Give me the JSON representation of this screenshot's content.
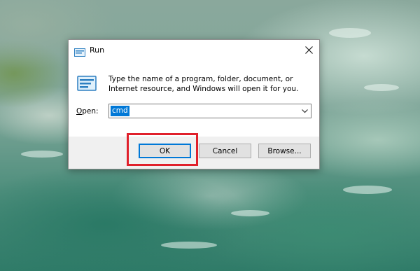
{
  "dialog": {
    "title": "Run",
    "description": "Type the name of a program, folder, document, or Internet resource, and Windows will open it for you.",
    "open_label_prefix": "",
    "open_label_underlined": "O",
    "open_label_rest": "pen:",
    "open_value": "cmd",
    "buttons": {
      "ok": "OK",
      "cancel": "Cancel",
      "browse": "Browse..."
    }
  },
  "icons": {
    "title": "run-icon",
    "main": "run-icon",
    "close": "close-icon",
    "dropdown": "chevron-down-icon"
  },
  "colors": {
    "highlight": "#e0202b",
    "selection": "#0078d7",
    "footer_bg": "#f0f0f0"
  }
}
